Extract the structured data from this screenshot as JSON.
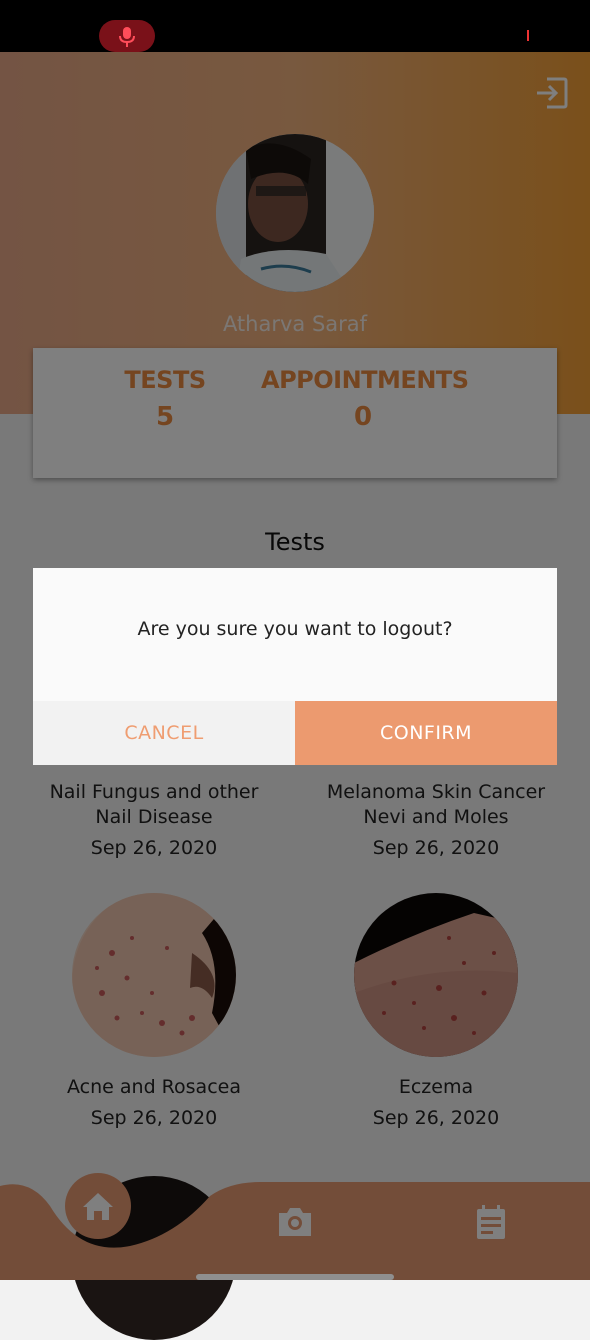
{
  "user": {
    "name": "Atharva Saraf"
  },
  "stats": [
    {
      "label": "TESTS",
      "value": "5"
    },
    {
      "label": "APPOINTMENTS",
      "value": "0"
    }
  ],
  "section_title": "Tests",
  "tests": [
    {
      "name_line1": "Nail Fungus and other",
      "name_line2": "Nail Disease",
      "date": "Sep 26, 2020"
    },
    {
      "name_line1": "Melanoma Skin Cancer",
      "name_line2": "Nevi and Moles",
      "date": "Sep 26, 2020"
    },
    {
      "name_line1": "Acne and Rosacea",
      "name_line2": "",
      "date": "Sep 26, 2020"
    },
    {
      "name_line1": "Eczema",
      "name_line2": "",
      "date": "Sep 26, 2020"
    }
  ],
  "dialog": {
    "message": "Are you sure you want to logout?",
    "cancel_label": "CANCEL",
    "confirm_label": "CONFIRM"
  },
  "nav": {
    "items": [
      {
        "icon": "home-icon",
        "active": true
      },
      {
        "icon": "camera-icon",
        "active": false
      },
      {
        "icon": "calendar-icon",
        "active": false
      }
    ]
  },
  "colors": {
    "accent": "#eb8a40",
    "confirm": "#ec9a6f",
    "nav": "#e79a73"
  }
}
